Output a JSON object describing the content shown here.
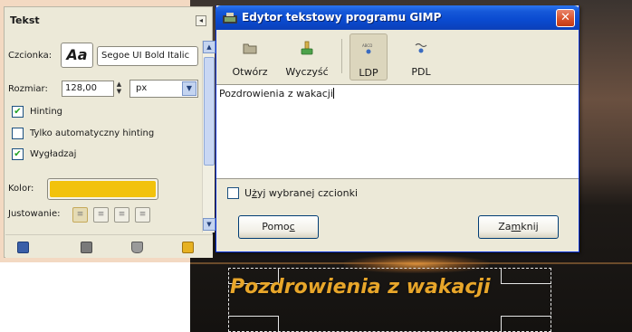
{
  "canvas": {
    "text": "Pozdrowienia z wakacji"
  },
  "tool_options": {
    "title": "Tekst",
    "font_label": "Czcionka:",
    "font_preview": "Aa",
    "font_name": "Segoe UI Bold Italic",
    "size_label": "Rozmiar:",
    "size_value": "128,00",
    "unit": "px",
    "hinting_label": "Hinting",
    "hinting_checked": true,
    "autohint_label": "Tylko automatyczny hinting",
    "autohint_checked": false,
    "antialias_label": "Wygładzaj",
    "antialias_checked": true,
    "color_label": "Kolor:",
    "color_value": "#f2c20c",
    "justify_label": "Justowanie:"
  },
  "dialog": {
    "title": "Edytor tekstowy programu GIMP",
    "toolbar": {
      "open_label": "Otwórz",
      "clear_label": "Wyczyść",
      "ltr_label": "LDP",
      "rtl_label": "PDL"
    },
    "text_content": "Pozdrowienia z wakacji",
    "use_font_label_pre": "U",
    "use_font_label_ul": "ż",
    "use_font_label_post": "yj wybranej czcionki",
    "help_pre": "Pomo",
    "help_ul": "c",
    "close_pre": "Za",
    "close_ul": "m",
    "close_post": "knij"
  }
}
